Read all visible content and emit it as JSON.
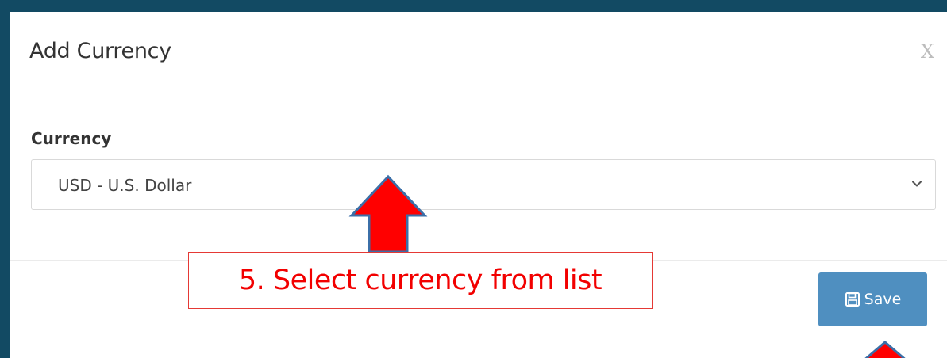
{
  "dialog": {
    "title": "Add Currency",
    "close_label": "X"
  },
  "form": {
    "currency_label": "Currency",
    "currency_selected": "USD - U.S. Dollar"
  },
  "footer": {
    "save_label": "Save"
  },
  "annotation": {
    "text": "5. Select currency from list"
  },
  "colors": {
    "background": "#124a63",
    "save_button": "#4f8fc0",
    "annotation_red": "#f20000"
  }
}
